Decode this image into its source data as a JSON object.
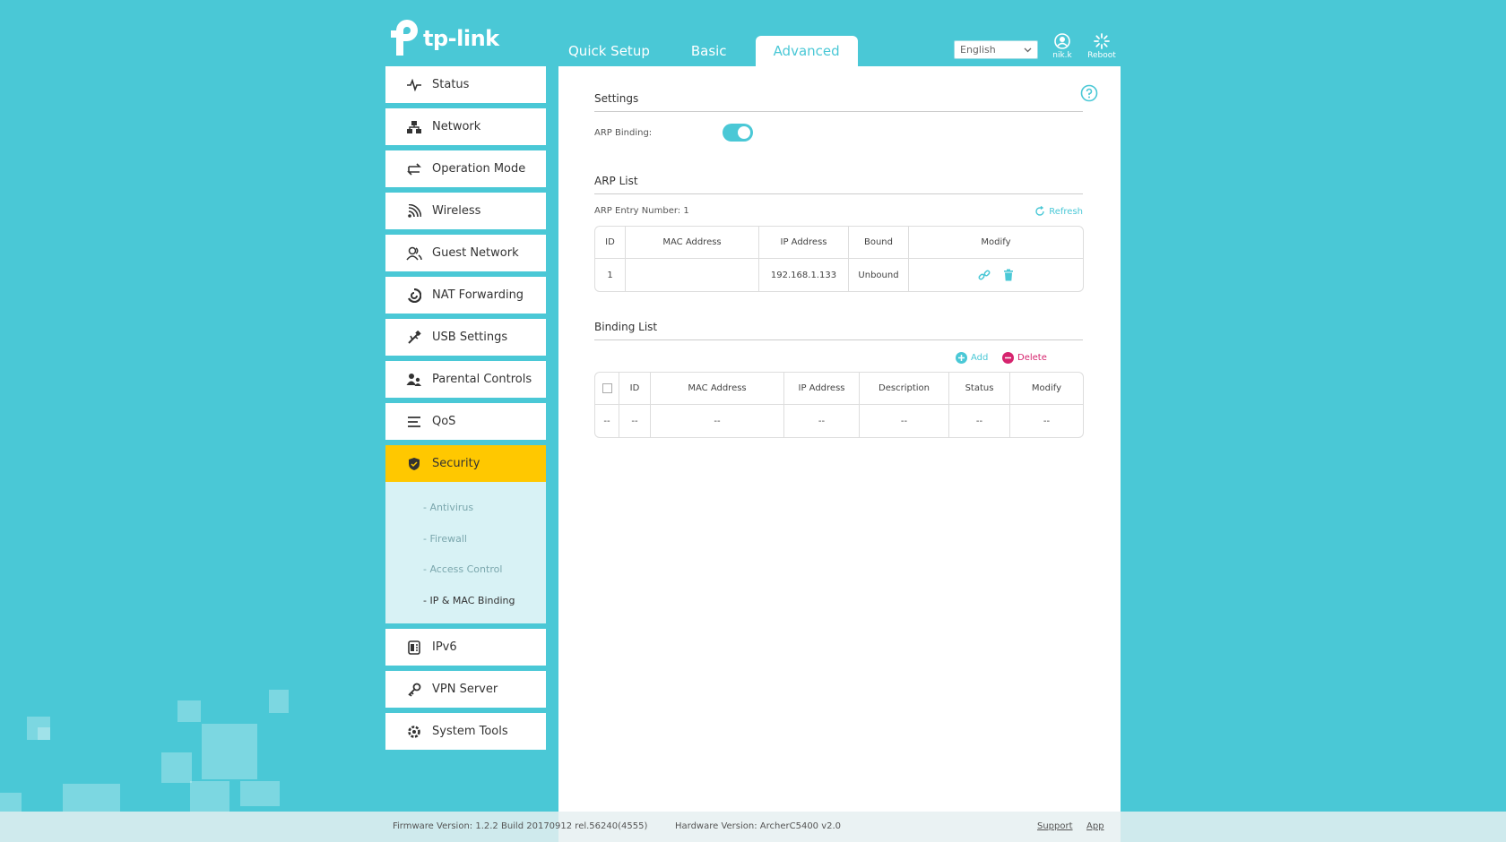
{
  "brand": {
    "logo_text": "tp-link"
  },
  "header": {
    "tabs": [
      {
        "label": "Quick Setup"
      },
      {
        "label": "Basic"
      },
      {
        "label": "Advanced"
      }
    ],
    "language": "English",
    "user_label": "nik.k",
    "reboot_label": "Reboot"
  },
  "sidebar": {
    "items": [
      {
        "label": "Status"
      },
      {
        "label": "Network"
      },
      {
        "label": "Operation Mode"
      },
      {
        "label": "Wireless"
      },
      {
        "label": "Guest Network"
      },
      {
        "label": "NAT Forwarding"
      },
      {
        "label": "USB Settings"
      },
      {
        "label": "Parental Controls"
      },
      {
        "label": "QoS"
      },
      {
        "label": "Security"
      },
      {
        "label": "IPv6"
      },
      {
        "label": "VPN Server"
      },
      {
        "label": "System Tools"
      }
    ],
    "security_sub": [
      {
        "label": "Antivirus"
      },
      {
        "label": "Firewall"
      },
      {
        "label": "Access Control"
      },
      {
        "label": "IP & MAC Binding"
      }
    ]
  },
  "settings": {
    "title": "Settings",
    "arp_binding_label": "ARP Binding:"
  },
  "arp_list": {
    "title": "ARP List",
    "entry_number_label": "ARP Entry Number:",
    "entry_number": "1",
    "refresh_label": "Refresh",
    "columns": [
      "ID",
      "MAC Address",
      "IP Address",
      "Bound",
      "Modify"
    ],
    "rows": [
      {
        "id": "1",
        "mac": "",
        "ip": "192.168.1.133",
        "bound": "Unbound"
      }
    ]
  },
  "binding_list": {
    "title": "Binding List",
    "add_label": "Add",
    "delete_label": "Delete",
    "columns": [
      "ID",
      "MAC Address",
      "IP Address",
      "Description",
      "Status",
      "Modify"
    ],
    "empty_row": [
      "--",
      "--",
      "--",
      "--",
      "--",
      "--",
      "--"
    ]
  },
  "footer": {
    "firmware": "Firmware Version: 1.2.2 Build 20170912 rel.56240(4555)",
    "hardware": "Hardware Version: ArcherC5400 v2.0",
    "support": "Support",
    "app": "App"
  },
  "colors": {
    "accent": "#4ac8d6",
    "active_nav": "#ffc800",
    "delete": "#d6246e"
  }
}
